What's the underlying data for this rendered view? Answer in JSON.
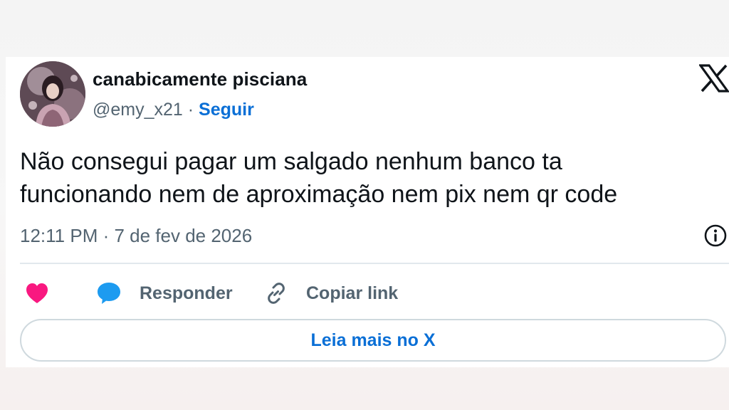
{
  "author": {
    "display_name": "canabicamente pisciana",
    "handle": "@emy_x21",
    "separator": " · ",
    "follow_label": "Seguir"
  },
  "tweet": {
    "text_lines": [
      "Não consegui pagar um salgado nenhum banco ta",
      "funcionando nem de aproximação nem pix nem qr code"
    ],
    "timestamp": "12:11 PM · 7 de fev de 2026"
  },
  "actions": {
    "like_icon": "heart-icon",
    "reply_icon": "speech-bubble-icon",
    "reply_label": "Responder",
    "copy_icon": "link-icon",
    "copy_label": "Copiar link"
  },
  "read_more": {
    "label": "Leia mais no X"
  },
  "icons": {
    "brand_logo": "x-logo-icon",
    "info": "info-icon"
  },
  "colors": {
    "text_primary": "#0f1419",
    "text_secondary": "#536471",
    "link_blue": "#0a6fd6",
    "like_pink": "#f91880",
    "reply_blue": "#1d9bf0",
    "border": "#cfd9de"
  }
}
